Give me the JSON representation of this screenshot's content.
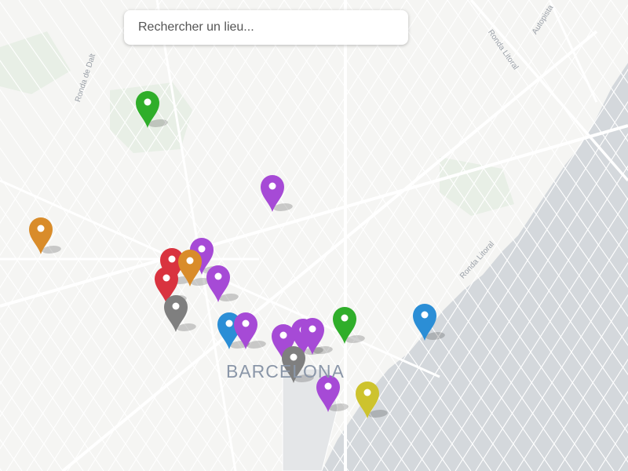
{
  "search": {
    "placeholder": "Rechercher un lieu..."
  },
  "map": {
    "city_label": "BARCELONA",
    "road_labels": {
      "ronda_dalt": "Ronda de Dalt",
      "ronda_litoral_top": "Ronda Litoral",
      "autopista": "Autopista",
      "ronda_litoral_coast": "Ronda Litoral"
    },
    "colors": {
      "land": "#f5f5f3",
      "sea": "#d4d8dc",
      "road": "#ffffff",
      "park": "#e8efe6"
    }
  },
  "markers": [
    {
      "id": "marker-1",
      "color": "#2fae2a"
    },
    {
      "id": "marker-2",
      "color": "#a64ad6"
    },
    {
      "id": "marker-3",
      "color": "#d98c2a"
    },
    {
      "id": "marker-4",
      "color": "#a64ad6"
    },
    {
      "id": "marker-5",
      "color": "#d9333f"
    },
    {
      "id": "marker-6",
      "color": "#d98c2a"
    },
    {
      "id": "marker-7",
      "color": "#d9333f"
    },
    {
      "id": "marker-8",
      "color": "#a64ad6"
    },
    {
      "id": "marker-9",
      "color": "#7f7f7f"
    },
    {
      "id": "marker-10",
      "color": "#2b8ed6"
    },
    {
      "id": "marker-11",
      "color": "#a64ad6"
    },
    {
      "id": "marker-12",
      "color": "#a64ad6"
    },
    {
      "id": "marker-13",
      "color": "#a64ad6"
    },
    {
      "id": "marker-14",
      "color": "#a64ad6"
    },
    {
      "id": "marker-15",
      "color": "#7f7f7f"
    },
    {
      "id": "marker-16",
      "color": "#2fae2a"
    },
    {
      "id": "marker-17",
      "color": "#2b8ed6"
    },
    {
      "id": "marker-18",
      "color": "#a64ad6"
    },
    {
      "id": "marker-19",
      "color": "#cdc32e"
    }
  ]
}
